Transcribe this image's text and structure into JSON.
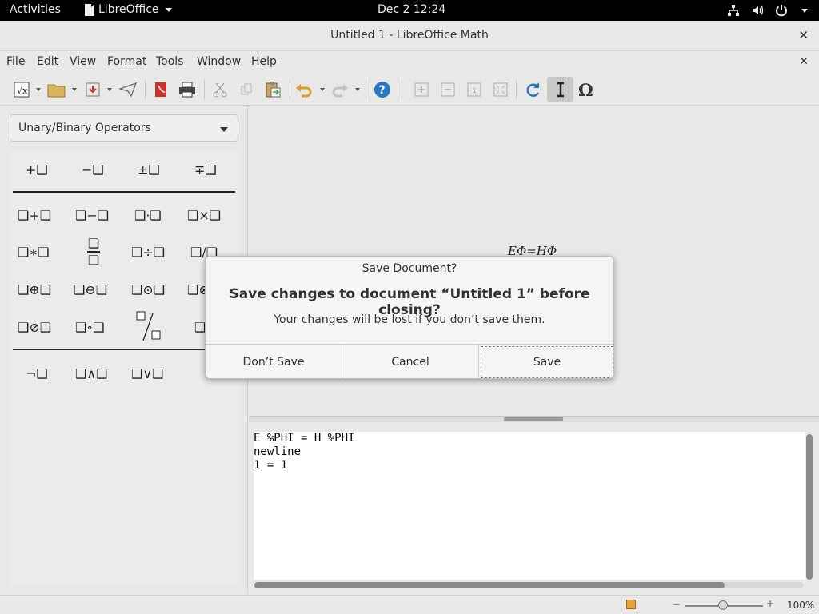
{
  "topbar": {
    "activities": "Activities",
    "app_name": "LibreOffice",
    "clock": "Dec 2  12:24"
  },
  "window": {
    "title": "Untitled 1 - LibreOffice Math",
    "close": "✕"
  },
  "menubar": {
    "items": [
      "File",
      "Edit",
      "View",
      "Format",
      "Tools",
      "Window",
      "Help"
    ],
    "doc_close": "✕"
  },
  "elements_panel": {
    "category": "Unary/Binary Operators",
    "symbols": {
      "unary": [
        "+❑",
        "−❑",
        "±❑",
        "∓❑"
      ],
      "row1": [
        "❑+❑",
        "❑−❑",
        "❑·❑",
        "❑×❑"
      ],
      "row2": [
        "❑∗❑",
        "",
        "❑÷❑",
        "❑/❑"
      ],
      "row3": [
        "❑⊕❑",
        "❑⊖❑",
        "❑⊙❑",
        "❑⊗❑"
      ],
      "row4": [
        "❑⊘❑",
        "❑∘❑",
        "",
        "❑\\❑"
      ],
      "logic": [
        "¬❑",
        "❑∧❑",
        "❑∨❑"
      ]
    }
  },
  "preview": {
    "formula": "EΦ=HΦ"
  },
  "editor": {
    "lines": [
      "E %PHI = H %PHI",
      "newline",
      "1 = 1"
    ]
  },
  "statusbar": {
    "zoom": "100%"
  },
  "dialog": {
    "title": "Save Document?",
    "heading": "Save changes to document “Untitled 1” before closing?",
    "message": "Your changes will be lost if you don’t save them.",
    "buttons": {
      "dont_save": "Don’t Save",
      "cancel": "Cancel",
      "save": "Save"
    }
  },
  "colors": {
    "topbar_bg": "#000000",
    "window_bg": "#e8e8e7",
    "dialog_bg": "#f6f5f4",
    "help_icon": "#2a76c6",
    "update_icon": "#2a76c6"
  }
}
